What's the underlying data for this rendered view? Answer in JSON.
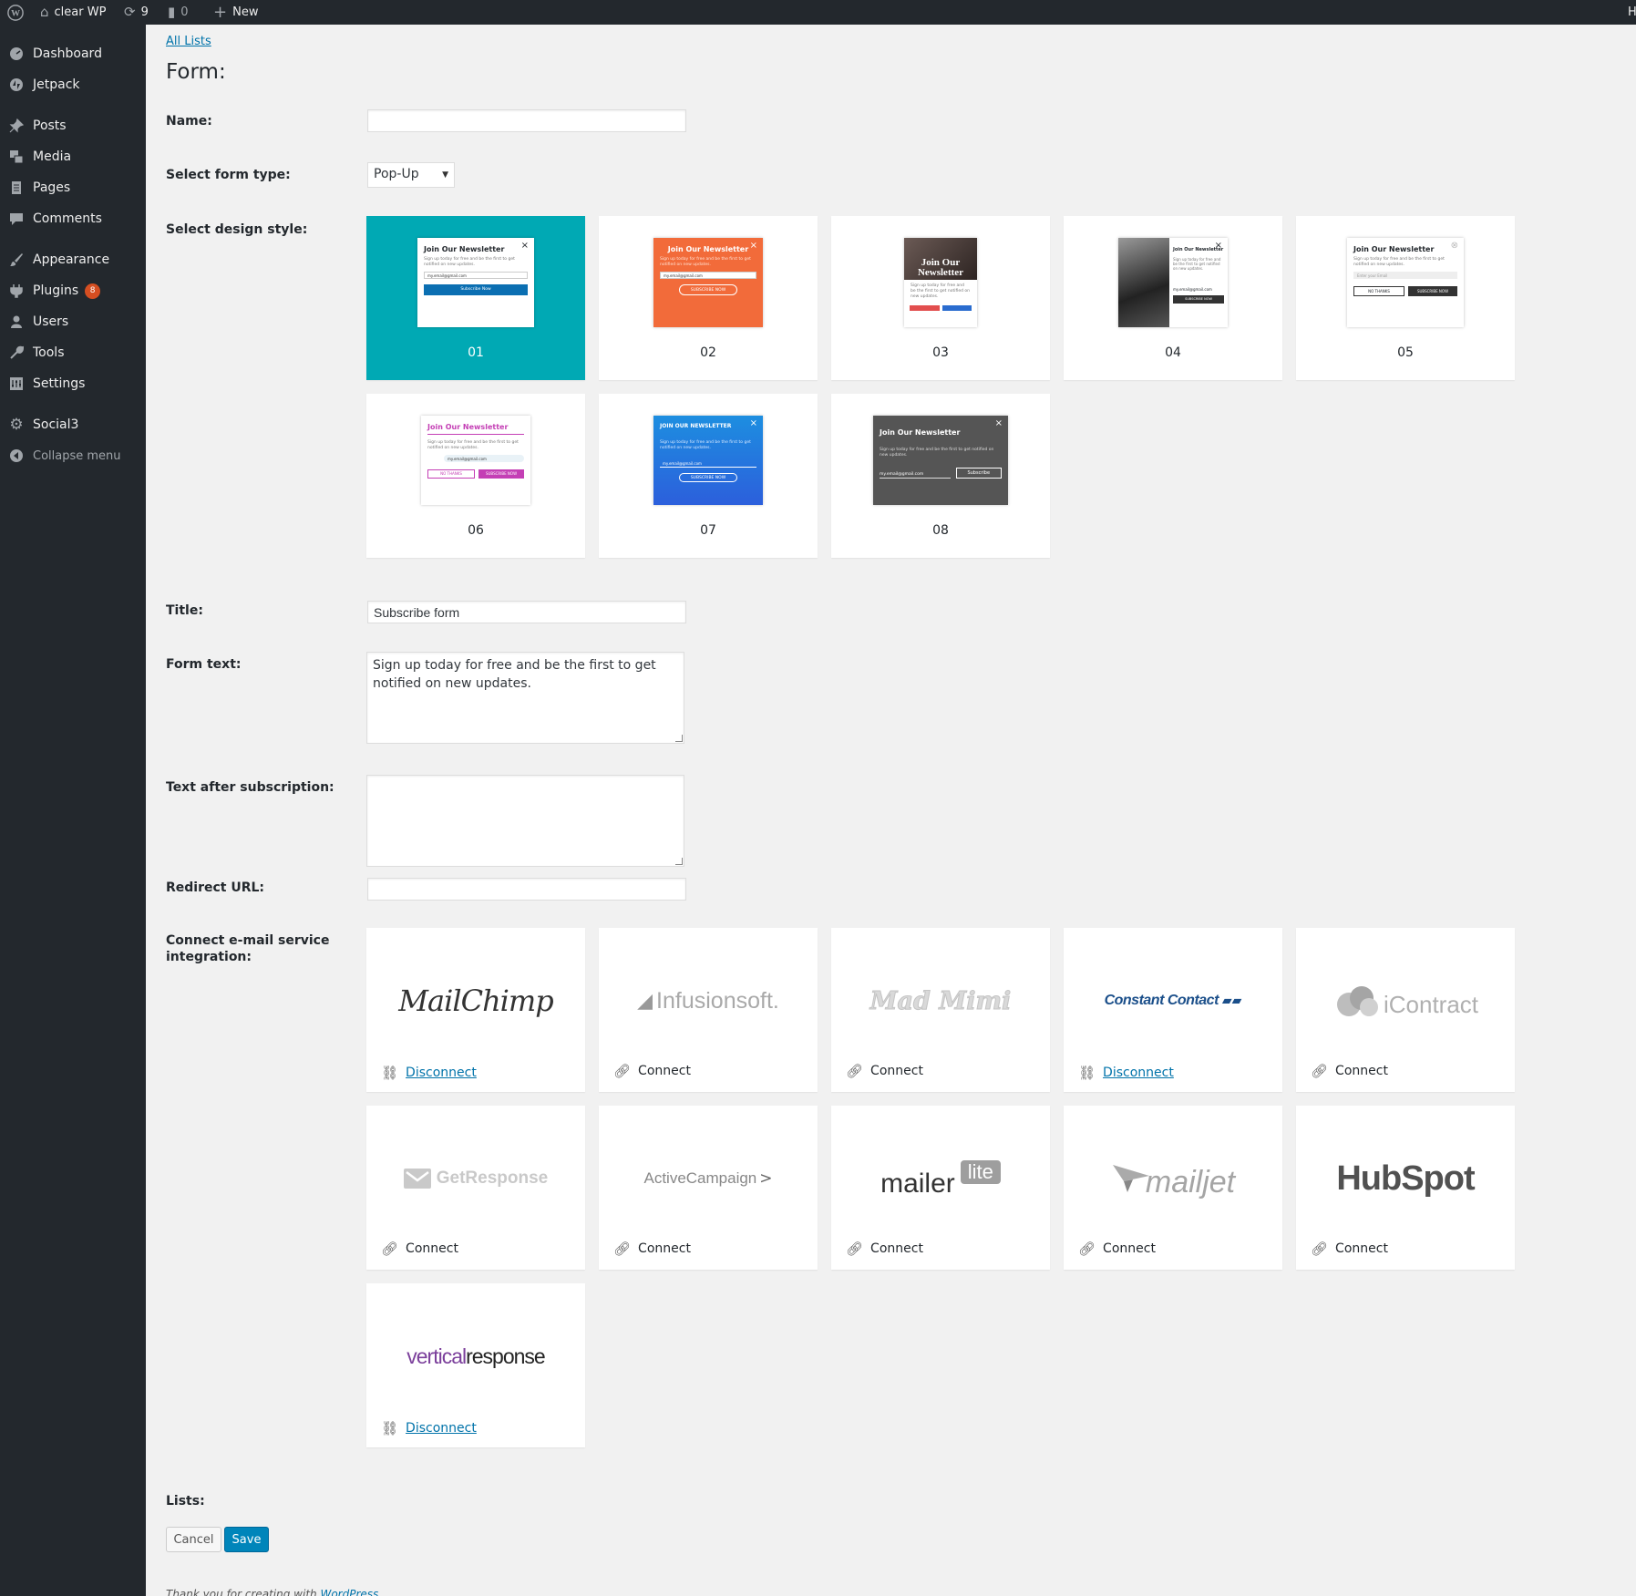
{
  "adminbar": {
    "site_name": "clear WP",
    "updates_count": "9",
    "comments_count": "0",
    "new_label": "New"
  },
  "sidebar": {
    "items": [
      {
        "label": "Dashboard",
        "icon": "dashboard-icon"
      },
      {
        "label": "Jetpack",
        "icon": "jetpack-icon"
      },
      {
        "label": "Posts",
        "icon": "pin-icon"
      },
      {
        "label": "Media",
        "icon": "media-icon"
      },
      {
        "label": "Pages",
        "icon": "pages-icon"
      },
      {
        "label": "Comments",
        "icon": "comment-icon"
      },
      {
        "label": "Appearance",
        "icon": "brush-icon"
      },
      {
        "label": "Plugins",
        "icon": "plugin-icon",
        "badge": "8"
      },
      {
        "label": "Users",
        "icon": "user-icon"
      },
      {
        "label": "Tools",
        "icon": "wrench-icon"
      },
      {
        "label": "Settings",
        "icon": "settings-icon"
      },
      {
        "label": "Social3",
        "icon": "gear-icon"
      },
      {
        "label": "Collapse menu",
        "icon": "collapse-icon"
      }
    ]
  },
  "main": {
    "back_link": "All Lists",
    "page_title": "Form:",
    "name_label": "Name:",
    "name_value": "",
    "form_type_label": "Select form type:",
    "form_type_value": "Pop-Up",
    "design_label": "Select design style:",
    "designs": [
      {
        "number": "01",
        "selected": true
      },
      {
        "number": "02"
      },
      {
        "number": "03"
      },
      {
        "number": "04"
      },
      {
        "number": "05"
      },
      {
        "number": "06"
      },
      {
        "number": "07"
      },
      {
        "number": "08"
      }
    ],
    "thumb_text": {
      "join": "Join Our Newsletter",
      "join_upper": "JOIN OUR NEWSLETTER",
      "join_two_line": "Join Our Newsletter",
      "body": "Sign up today for free and be the first to get notified on new updates.",
      "email": "my.email@gmail.com",
      "enter_email": "Enter your Email",
      "subscribe_now": "Subscribe Now",
      "subscribe_upper": "SUBSCRIBE NOW",
      "subscribe": "Subscribe",
      "no_thanks": "NO THANKS"
    },
    "title_label": "Title:",
    "title_value": "Subscribe form",
    "form_text_label": "Form text:",
    "form_text_value": "Sign up today for free and be the first to get notified on new updates.",
    "after_sub_label": "Text after subscription:",
    "after_sub_value": "",
    "redirect_label": "Redirect URL:",
    "redirect_value": "",
    "integration_label": "Connect e-mail service integration:",
    "services": [
      {
        "name": "MailChimp",
        "action": "Disconnect"
      },
      {
        "name": "Infusionsoft.",
        "action": "Connect"
      },
      {
        "name": "Mad Mimi",
        "action": "Connect"
      },
      {
        "name": "Constant Contact",
        "action": "Disconnect"
      },
      {
        "name": "iContract",
        "action": "Connect"
      },
      {
        "name": "GetResponse",
        "action": "Connect"
      },
      {
        "name": "ActiveCampaign",
        "action": "Connect"
      },
      {
        "name": "mailer",
        "name2": "lite",
        "action": "Connect"
      },
      {
        "name": "mailjet",
        "action": "Connect"
      },
      {
        "name": "HubSpot",
        "action": "Connect"
      },
      {
        "name": "vertical",
        "name2": "response",
        "action": "Disconnect"
      }
    ],
    "lists_label": "Lists:",
    "cancel_label": "Cancel",
    "save_label": "Save",
    "footer_text": "Thank you for creating with",
    "footer_link": "WordPress"
  },
  "colors": {
    "selected_card": "#00a9b4",
    "link": "#0073aa",
    "save_button": "#0085ba",
    "badge": "#d54e21"
  }
}
